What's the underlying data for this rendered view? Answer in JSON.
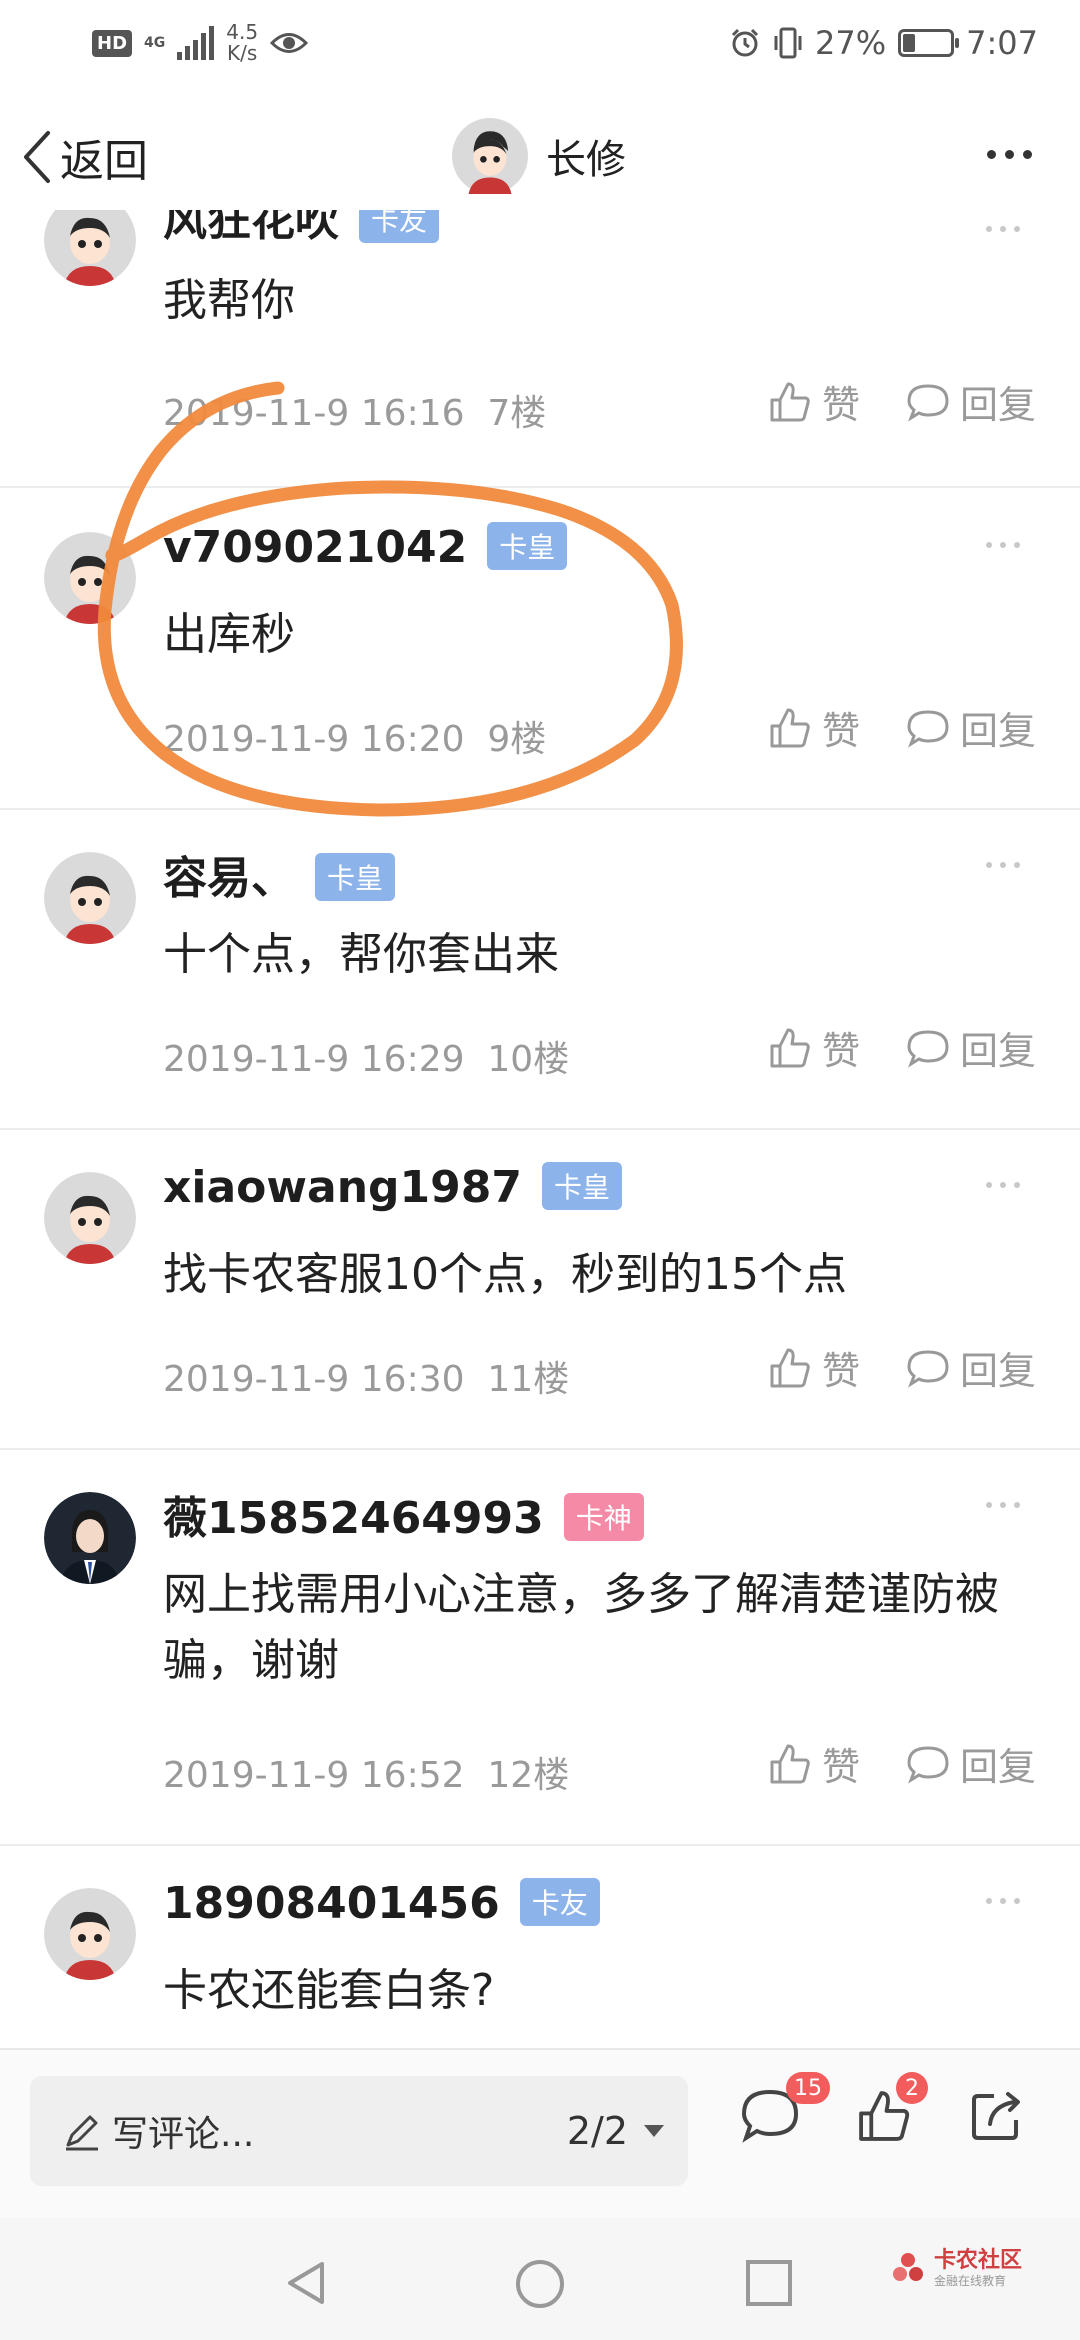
{
  "status_bar": {
    "hd": "HD",
    "network": "4G",
    "speed_value": "4.5",
    "speed_unit": "K/s",
    "battery_percent": "27%",
    "battery_level": 0.27,
    "time": "7:07"
  },
  "header": {
    "back_label": "返回",
    "title": "长修"
  },
  "comments": [
    {
      "username": "风狂花吹",
      "badge": "卡友",
      "text": "我帮你",
      "time": "2019-11-9 16:16",
      "floor": "7楼",
      "like": "赞",
      "reply": "回复"
    },
    {
      "username": "v709021042",
      "badge": "卡皇",
      "text": "出库秒",
      "time": "2019-11-9 16:20",
      "floor": "9楼",
      "like": "赞",
      "reply": "回复"
    },
    {
      "username": "容易、",
      "badge": "卡皇",
      "text": "十个点，帮你套出来",
      "time": "2019-11-9 16:29",
      "floor": "10楼",
      "like": "赞",
      "reply": "回复"
    },
    {
      "username": "xiaowang1987",
      "badge": "卡皇",
      "text": "找卡农客服10个点，秒到的15个点",
      "time": "2019-11-9 16:30",
      "floor": "11楼",
      "like": "赞",
      "reply": "回复"
    },
    {
      "username": "薇15852464993",
      "badge": "卡神",
      "text": "网上找需用小心注意，多多了解清楚谨防被骗，谢谢",
      "time": "2019-11-9 16:52",
      "floor": "12楼",
      "like": "赞",
      "reply": "回复"
    },
    {
      "username": "18908401456",
      "badge": "卡友",
      "text": "卡农还能套白条?",
      "time": "",
      "floor": "",
      "like": "",
      "reply": ""
    }
  ],
  "bottom_bar": {
    "compose_placeholder": "写评论...",
    "page_indicator": "2/2",
    "comment_count": "15",
    "like_count": "2"
  },
  "watermark": {
    "title": "卡农社区",
    "subtitle": "金融在线教育"
  },
  "colors": {
    "badge_blue": "#8db4ea",
    "badge_pink": "#f48aa6",
    "annotation_orange": "#f08a3c",
    "count_red": "#f25c5c"
  }
}
